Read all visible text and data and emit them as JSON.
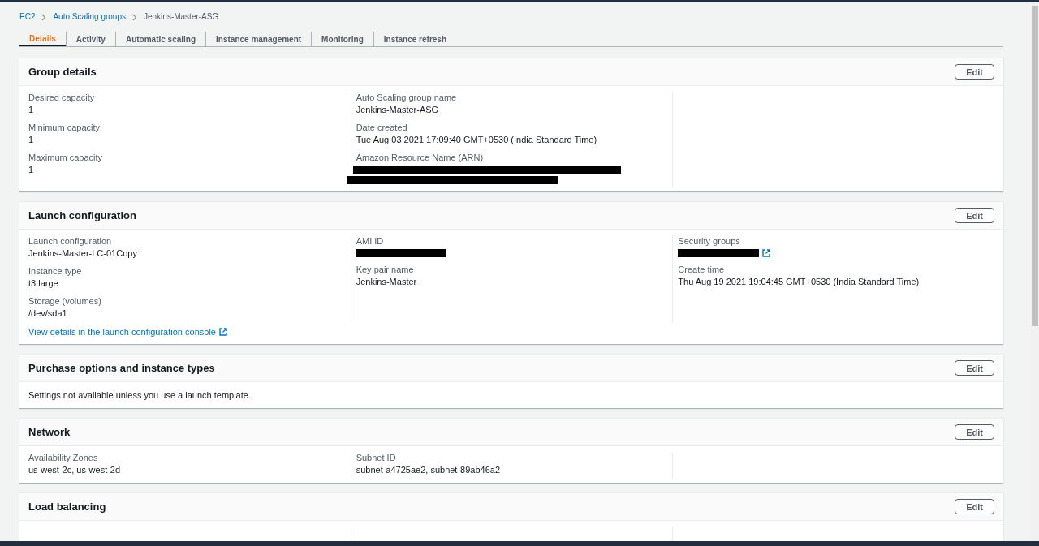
{
  "breadcrumb": [
    {
      "label": "EC2",
      "kind": "link"
    },
    {
      "label": "Auto Scaling groups",
      "kind": "link"
    },
    {
      "label": "Jenkins-Master-ASG",
      "kind": "current"
    }
  ],
  "tabs": [
    {
      "label": "Details",
      "selected": true
    },
    {
      "label": "Activity",
      "selected": false
    },
    {
      "label": "Automatic scaling",
      "selected": false
    },
    {
      "label": "Instance management",
      "selected": false
    },
    {
      "label": "Monitoring",
      "selected": false
    },
    {
      "label": "Instance refresh",
      "selected": false
    }
  ],
  "sections": [
    {
      "title": "Group details",
      "edit": "Edit",
      "columns": [
        [
          {
            "label": "Desired capacity",
            "value": "1",
            "kind": "text"
          },
          {
            "label": "Minimum capacity",
            "value": "1",
            "kind": "text"
          },
          {
            "label": "Maximum capacity",
            "value": "1",
            "kind": "text"
          }
        ],
        [
          {
            "label": "Auto Scaling group name",
            "value": "Jenkins-Master-ASG",
            "kind": "text"
          },
          {
            "label": "Date created",
            "value": "Tue Aug 03 2021 17:09:40 GMT+0530 (India Standard Time)",
            "kind": "text"
          },
          {
            "label": "Amazon Resource Name (ARN)",
            "kind": "redacted-long"
          }
        ],
        []
      ]
    },
    {
      "title": "Launch configuration",
      "edit": "Edit",
      "columns": [
        [
          {
            "label": "Launch configuration",
            "value": "Jenkins-Master-LC-01Copy",
            "kind": "text"
          },
          {
            "label": "Instance type",
            "value": "t3.large",
            "kind": "text"
          },
          {
            "label": "Storage (volumes)",
            "value": "/dev/sda1",
            "kind": "text"
          }
        ],
        [
          {
            "label": "AMI ID",
            "kind": "redacted"
          },
          {
            "label": "Key pair name",
            "value": "Jenkins-Master",
            "kind": "text"
          }
        ],
        [
          {
            "label": "Security groups",
            "kind": "redacted-link"
          },
          {
            "label": "Create time",
            "value": "Thu Aug 19 2021 19:04:45 GMT+0530 (India Standard Time)",
            "kind": "text"
          }
        ]
      ],
      "link": "View details in the launch configuration console"
    },
    {
      "title": "Purchase options and instance types",
      "edit": "Edit",
      "note": "Settings not available unless you use a launch template."
    },
    {
      "title": "Network",
      "edit": "Edit",
      "columns": [
        [
          {
            "label": "Availability Zones",
            "value": "us-west-2c, us-west-2d",
            "kind": "text"
          }
        ],
        [
          {
            "label": "Subnet ID",
            "value": "subnet-a4725ae2, subnet-89ab46a2",
            "kind": "text"
          }
        ],
        []
      ]
    },
    {
      "title": "Load balancing",
      "edit": "Edit",
      "columns": [
        [],
        [],
        []
      ]
    }
  ]
}
